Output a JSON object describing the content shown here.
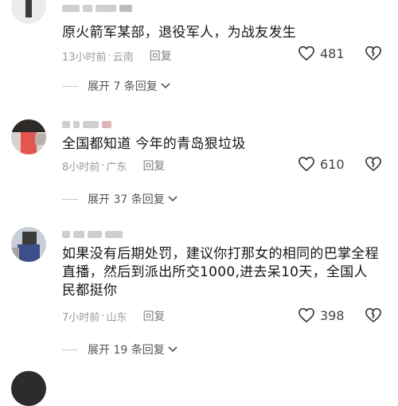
{
  "comments": [
    {
      "text": "原火箭军某部，退役军人，为战友发生",
      "time": "13小时前",
      "location": "云南",
      "reply_label": "回复",
      "likes": "481",
      "expand": "展开 7 条回复"
    },
    {
      "text": "全国都知道 今年的青岛狠垃圾",
      "time": "8小时前",
      "location": "广东",
      "reply_label": "回复",
      "likes": "610",
      "expand": "展开 37 条回复"
    },
    {
      "text": "如果没有后期处罚，建议你打那女的相同的巴掌全程直播，然后到派出所交1000,进去呆10天，全国人民都挺你",
      "time": "7小时前",
      "location": "山东",
      "reply_label": "回复",
      "likes": "398",
      "expand": "展开 19 条回复"
    }
  ],
  "separator": "·",
  "icons": {
    "like": "heart-outline-icon",
    "dislike": "broken-heart-icon",
    "expand": "chevron-down-icon"
  },
  "colors": {
    "text": "#161616",
    "meta": "#9a9a9a",
    "icon": "#444444"
  }
}
